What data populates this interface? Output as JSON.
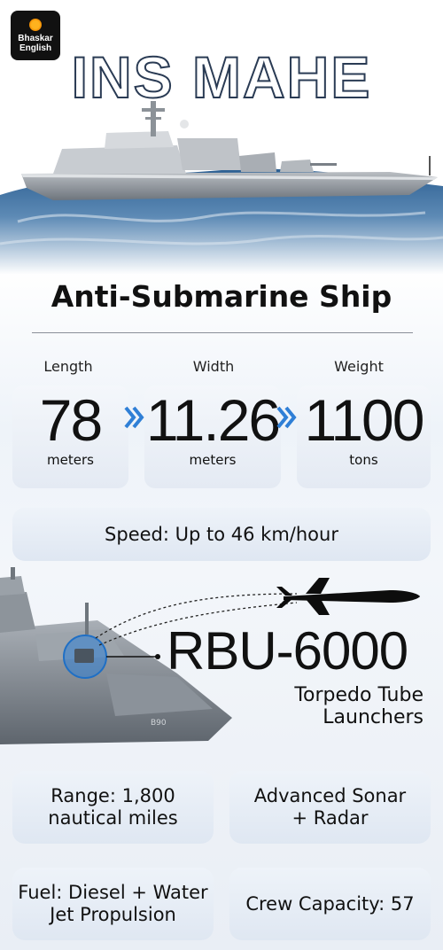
{
  "brand": {
    "line1": "Bhaskar",
    "line2": "English"
  },
  "title": "INS MAHE",
  "subtitle": "Anti-Submarine Ship",
  "stats": [
    {
      "label": "Length",
      "value": "78",
      "unit": "meters"
    },
    {
      "label": "Width",
      "value": "11.26",
      "unit": "meters"
    },
    {
      "label": "Weight",
      "value": "1100",
      "unit": "tons"
    }
  ],
  "speed": "Speed: Up to 46 km/hour",
  "weapon": {
    "name": "RBU-6000",
    "desc_line1": "Torpedo Tube",
    "desc_line2": "Launchers"
  },
  "features": [
    {
      "line1": "Range: 1,800",
      "line2": "nautical miles"
    },
    {
      "line1": "Advanced Sonar",
      "line2": "+ Radar"
    },
    {
      "line1": "Fuel: Diesel + Water",
      "line2": "Jet Propulsion"
    },
    {
      "line1": "Crew Capacity: 57",
      "line2": ""
    }
  ],
  "colors": {
    "accent": "#2f7fd6",
    "title_stroke": "#2a3b54",
    "sea": "#3f6f9e"
  }
}
